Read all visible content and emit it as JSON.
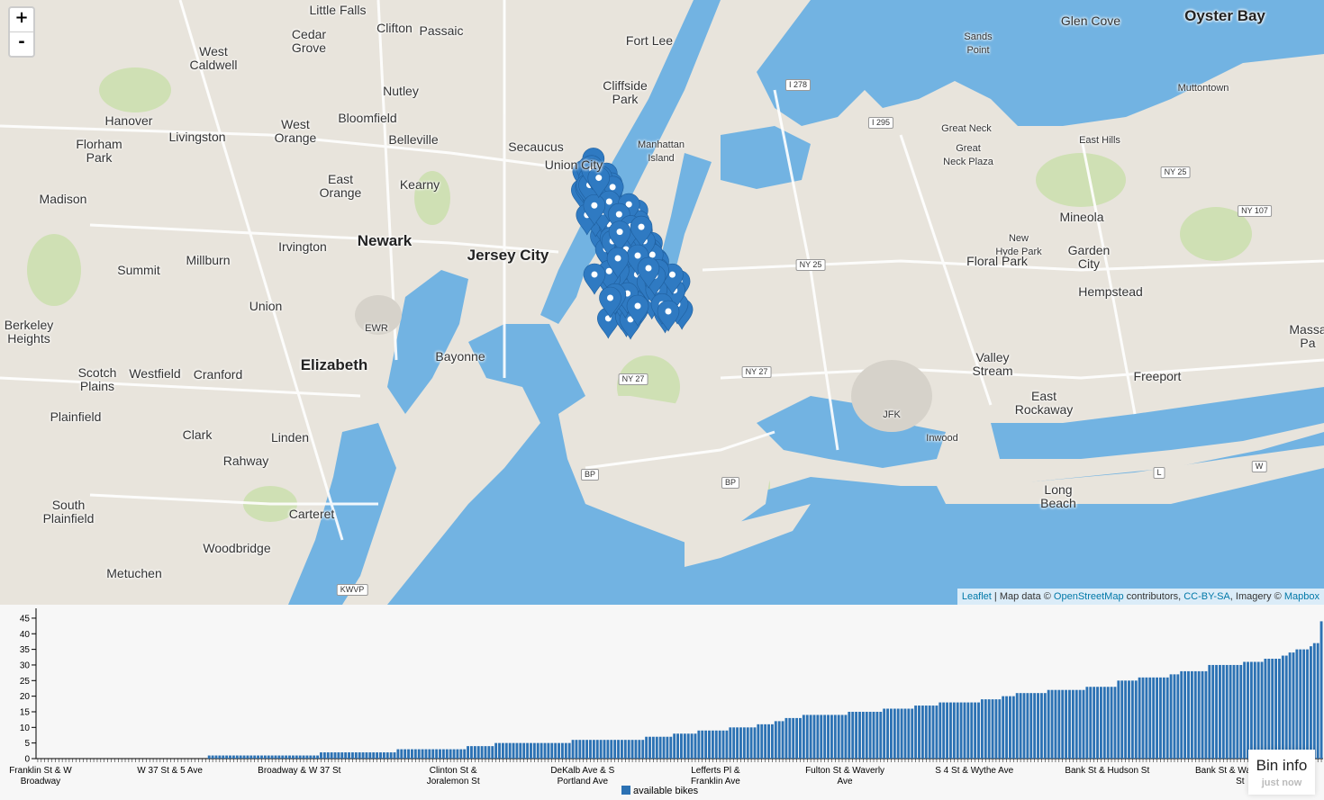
{
  "map": {
    "zoom_in": "+",
    "zoom_out": "-",
    "labels": [
      {
        "text": "Little Falls",
        "size": "n"
      },
      {
        "text": "Clifton",
        "size": "n"
      },
      {
        "text": "Passaic",
        "size": "n"
      },
      {
        "text": "Cedar\nGrove",
        "size": "n"
      },
      {
        "text": "West\nCaldwell",
        "size": "n"
      },
      {
        "text": "Fort Lee",
        "size": "n"
      },
      {
        "text": "Glen Cove",
        "size": "n"
      },
      {
        "text": "Oyster Bay",
        "size": "b"
      },
      {
        "text": "Sands\nPoint",
        "size": "s"
      },
      {
        "text": "Cliffside\nPark",
        "size": "n"
      },
      {
        "text": "Nutley",
        "size": "n"
      },
      {
        "text": "Muttontown",
        "size": "s"
      },
      {
        "text": "Hanover",
        "size": "n"
      },
      {
        "text": "West\nOrange",
        "size": "n"
      },
      {
        "text": "Bloomfield",
        "size": "n"
      },
      {
        "text": "Great Neck",
        "size": "s"
      },
      {
        "text": "Florham\nPark",
        "size": "n"
      },
      {
        "text": "Livingston",
        "size": "n"
      },
      {
        "text": "Belleville",
        "size": "n"
      },
      {
        "text": "Manhattan\nIsland",
        "size": "s"
      },
      {
        "text": "Great\nNeck Plaza",
        "size": "s"
      },
      {
        "text": "East Hills",
        "size": "s"
      },
      {
        "text": "Secaucus",
        "size": "n"
      },
      {
        "text": "Union City",
        "size": "n"
      },
      {
        "text": "East\nOrange",
        "size": "n"
      },
      {
        "text": "Kearny",
        "size": "n"
      },
      {
        "text": "Madison",
        "size": "n"
      },
      {
        "text": "Mineola",
        "size": "n"
      },
      {
        "text": "Newark",
        "size": "b"
      },
      {
        "text": "Jersey City",
        "size": "b"
      },
      {
        "text": "Irvington",
        "size": "n"
      },
      {
        "text": "New\nHyde Park",
        "size": "s"
      },
      {
        "text": "Garden\nCity",
        "size": "n"
      },
      {
        "text": "Floral Park",
        "size": "n"
      },
      {
        "text": "Summit",
        "size": "n"
      },
      {
        "text": "Millburn",
        "size": "n"
      },
      {
        "text": "Hempstead",
        "size": "n"
      },
      {
        "text": "Union",
        "size": "n"
      },
      {
        "text": "EWR",
        "size": "s"
      },
      {
        "text": "Berkeley\nHeights",
        "size": "n"
      },
      {
        "text": "Massa\nPa",
        "size": "n"
      },
      {
        "text": "Bayonne",
        "size": "n"
      },
      {
        "text": "Valley\nStream",
        "size": "n"
      },
      {
        "text": "Elizabeth",
        "size": "b"
      },
      {
        "text": "Scotch\nPlains",
        "size": "n"
      },
      {
        "text": "Westfield",
        "size": "n"
      },
      {
        "text": "Cranford",
        "size": "n"
      },
      {
        "text": "Freeport",
        "size": "n"
      },
      {
        "text": "East\nRockaway",
        "size": "n"
      },
      {
        "text": "JFK",
        "size": "s"
      },
      {
        "text": "Plainfield",
        "size": "n"
      },
      {
        "text": "Inwood",
        "size": "s"
      },
      {
        "text": "Clark",
        "size": "n"
      },
      {
        "text": "Linden",
        "size": "n"
      },
      {
        "text": "Rahway",
        "size": "n"
      },
      {
        "text": "Long\nBeach",
        "size": "n"
      },
      {
        "text": "South\nPlainfield",
        "size": "n"
      },
      {
        "text": "Carteret",
        "size": "n"
      },
      {
        "text": "Woodbridge",
        "size": "n"
      },
      {
        "text": "Metuchen",
        "size": "n"
      }
    ],
    "shields": [
      "I 278",
      "I 295",
      "NY 25",
      "NY 107",
      "NY 25",
      "NY 27",
      "NY 27",
      "BP",
      "BP",
      "L",
      "W",
      "KWVP"
    ],
    "attribution": {
      "leaflet": "Leaflet",
      "sep1": " | Map data © ",
      "osm": "OpenStreetMap",
      "mid": " contributors, ",
      "license": "CC-BY-SA",
      "imagery": ", Imagery © ",
      "mapbox": "Mapbox"
    }
  },
  "chart_data": {
    "type": "bar",
    "ylim": [
      0,
      47
    ],
    "yticks": [
      0,
      5,
      10,
      15,
      20,
      25,
      30,
      35,
      40,
      45
    ],
    "legend": "available bikes",
    "color": "#2c72b4",
    "shown_category_labels": [
      "Franklin St & W\nBroadway",
      "W 37 St & 5 Ave",
      "Broadway & W 37 St",
      "Clinton St &\nJoralemon St",
      "DeKalb Ave & S\nPortland Ave",
      "Lefferts Pl &\nFranklin Ave",
      "Fulton St & Waverly\nAve",
      "S 4 St & Wythe Ave",
      "Bank St & Hudson St",
      "Bank St & Washington\nSt"
    ],
    "values": [
      0,
      0,
      0,
      0,
      0,
      0,
      0,
      0,
      0,
      0,
      0,
      0,
      0,
      0,
      0,
      0,
      0,
      0,
      0,
      0,
      0,
      0,
      0,
      0,
      0,
      0,
      0,
      0,
      0,
      0,
      0,
      0,
      0,
      0,
      0,
      0,
      0,
      0,
      0,
      0,
      0,
      0,
      0,
      0,
      0,
      0,
      0,
      0,
      0,
      1,
      1,
      1,
      1,
      1,
      1,
      1,
      1,
      1,
      1,
      1,
      1,
      1,
      1,
      1,
      1,
      1,
      1,
      1,
      1,
      1,
      1,
      1,
      1,
      1,
      1,
      1,
      1,
      1,
      1,
      1,
      1,
      2,
      2,
      2,
      2,
      2,
      2,
      2,
      2,
      2,
      2,
      2,
      2,
      2,
      2,
      2,
      2,
      2,
      2,
      2,
      2,
      2,
      2,
      3,
      3,
      3,
      3,
      3,
      3,
      3,
      3,
      3,
      3,
      3,
      3,
      3,
      3,
      3,
      3,
      3,
      3,
      3,
      3,
      4,
      4,
      4,
      4,
      4,
      4,
      4,
      4,
      5,
      5,
      5,
      5,
      5,
      5,
      5,
      5,
      5,
      5,
      5,
      5,
      5,
      5,
      5,
      5,
      5,
      5,
      5,
      5,
      5,
      5,
      6,
      6,
      6,
      6,
      6,
      6,
      6,
      6,
      6,
      6,
      6,
      6,
      6,
      6,
      6,
      6,
      6,
      6,
      6,
      6,
      6,
      7,
      7,
      7,
      7,
      7,
      7,
      7,
      7,
      8,
      8,
      8,
      8,
      8,
      8,
      8,
      9,
      9,
      9,
      9,
      9,
      9,
      9,
      9,
      9,
      10,
      10,
      10,
      10,
      10,
      10,
      10,
      10,
      11,
      11,
      11,
      11,
      11,
      12,
      12,
      12,
      13,
      13,
      13,
      13,
      13,
      14,
      14,
      14,
      14,
      14,
      14,
      14,
      14,
      14,
      14,
      14,
      14,
      14,
      15,
      15,
      15,
      15,
      15,
      15,
      15,
      15,
      15,
      15,
      16,
      16,
      16,
      16,
      16,
      16,
      16,
      16,
      16,
      17,
      17,
      17,
      17,
      17,
      17,
      17,
      18,
      18,
      18,
      18,
      18,
      18,
      18,
      18,
      18,
      18,
      18,
      18,
      19,
      19,
      19,
      19,
      19,
      19,
      20,
      20,
      20,
      20,
      21,
      21,
      21,
      21,
      21,
      21,
      21,
      21,
      21,
      22,
      22,
      22,
      22,
      22,
      22,
      22,
      22,
      22,
      22,
      22,
      23,
      23,
      23,
      23,
      23,
      23,
      23,
      23,
      23,
      25,
      25,
      25,
      25,
      25,
      25,
      26,
      26,
      26,
      26,
      26,
      26,
      26,
      26,
      26,
      27,
      27,
      27,
      28,
      28,
      28,
      28,
      28,
      28,
      28,
      28,
      30,
      30,
      30,
      30,
      30,
      30,
      30,
      30,
      30,
      30,
      31,
      31,
      31,
      31,
      31,
      31,
      32,
      32,
      32,
      32,
      32,
      33,
      33,
      34,
      34,
      35,
      35,
      35,
      35,
      36,
      37,
      37,
      44
    ]
  },
  "bin_info": {
    "title": "Bin info",
    "subtitle": "just now"
  }
}
